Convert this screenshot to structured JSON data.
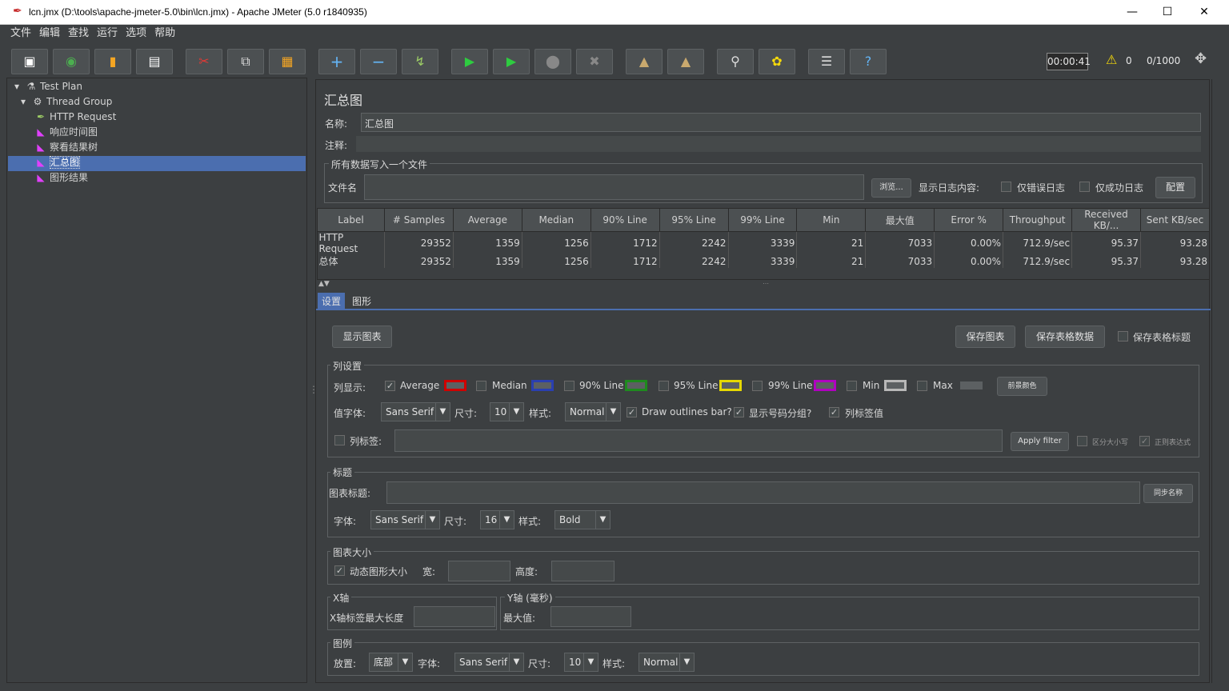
{
  "window": {
    "title": "lcn.jmx (D:\\tools\\apache-jmeter-5.0\\bin\\lcn.jmx) - Apache JMeter (5.0 r1840935)"
  },
  "menu": [
    "文件",
    "编辑",
    "查找",
    "运行",
    "选项",
    "帮助"
  ],
  "toolbar": {
    "timer": "00:00:41",
    "warnings": "0",
    "threads": "0/1000"
  },
  "tree": [
    {
      "label": "Test Plan",
      "icon": "test-plan-icon"
    },
    {
      "label": "Thread Group",
      "icon": "thread-group-icon"
    },
    {
      "label": "HTTP Request",
      "icon": "sampler-icon"
    },
    {
      "label": "响应时间图",
      "icon": "listener-icon"
    },
    {
      "label": "察看结果树",
      "icon": "listener-icon"
    },
    {
      "label": "汇总图",
      "icon": "listener-icon",
      "selected": true
    },
    {
      "label": "图形结果",
      "icon": "listener-icon"
    }
  ],
  "panel": {
    "heading": "汇总图",
    "name_label": "名称:",
    "name_value": "汇总图",
    "comment_label": "注释:",
    "file_group": "所有数据写入一个文件",
    "file_label": "文件名",
    "browse": "浏览...",
    "log_label": "显示日志内容:",
    "errors_only": "仅错误日志",
    "success_only": "仅成功日志",
    "configure": "配置"
  },
  "table": {
    "headers": [
      "Label",
      "# Samples",
      "Average",
      "Median",
      "90% Line",
      "95% Line",
      "99% Line",
      "Min",
      "最大值",
      "Error %",
      "Throughput",
      "Received KB/...",
      "Sent KB/sec"
    ],
    "rows": [
      [
        "HTTP Request",
        "29352",
        "1359",
        "1256",
        "1712",
        "2242",
        "3339",
        "21",
        "7033",
        "0.00%",
        "712.9/sec",
        "95.37",
        "93.28"
      ],
      [
        "总体",
        "29352",
        "1359",
        "1256",
        "1712",
        "2242",
        "3339",
        "21",
        "7033",
        "0.00%",
        "712.9/sec",
        "95.37",
        "93.28"
      ]
    ]
  },
  "tabs": [
    "设置",
    "图形"
  ],
  "settings": {
    "show_chart": "显示图表",
    "save_chart": "保存图表",
    "save_table": "保存表格数据",
    "save_header": "保存表格标题",
    "columns_group": "列设置",
    "columns_label": "列显示:",
    "columns": [
      {
        "name": "Average",
        "checked": true,
        "color": "#d00000"
      },
      {
        "name": "Median",
        "checked": false,
        "color": "#2a3fb0"
      },
      {
        "name": "90% Line",
        "checked": false,
        "color": "#1e8a1e"
      },
      {
        "name": "95% Line",
        "checked": false,
        "color": "#e6d800"
      },
      {
        "name": "99% Line",
        "checked": false,
        "color": "#b000c0"
      },
      {
        "name": "Min",
        "checked": false,
        "color": "#b8b8b8"
      },
      {
        "name": "Max",
        "checked": false,
        "color": "#5c6062"
      }
    ],
    "fg_color": "前景颜色",
    "value_font_label": "值字体:",
    "font": "Sans Serif",
    "size_label": "尺寸:",
    "size": "10",
    "style_label": "样式:",
    "style": "Normal",
    "draw_outlines": "Draw outlines bar?",
    "show_grouping": "显示号码分组?",
    "col_label_value": "列标签值",
    "col_label": "列标签:",
    "apply_filter": "Apply filter",
    "case_sensitive": "区分大小写",
    "regex": "正则表达式",
    "title_group": "标题",
    "chart_title_label": "图表标题:",
    "sync_name": "同步名称",
    "title_font_label": "字体:",
    "title_font": "Sans Serif",
    "title_size": "16",
    "title_style": "Bold",
    "size_group": "图表大小",
    "dynamic_size": "动态图形大小",
    "width_label": "宽:",
    "height_label": "高度:",
    "x_group": "X轴",
    "x_max_label": "X轴标签最大长度",
    "y_group": "Y轴 (毫秒)",
    "y_max_label": "最大值:",
    "legend_group": "图例",
    "placement_label": "放置:",
    "placement": "底部",
    "legend_font": "Sans Serif",
    "legend_size": "10",
    "legend_style": "Normal"
  }
}
